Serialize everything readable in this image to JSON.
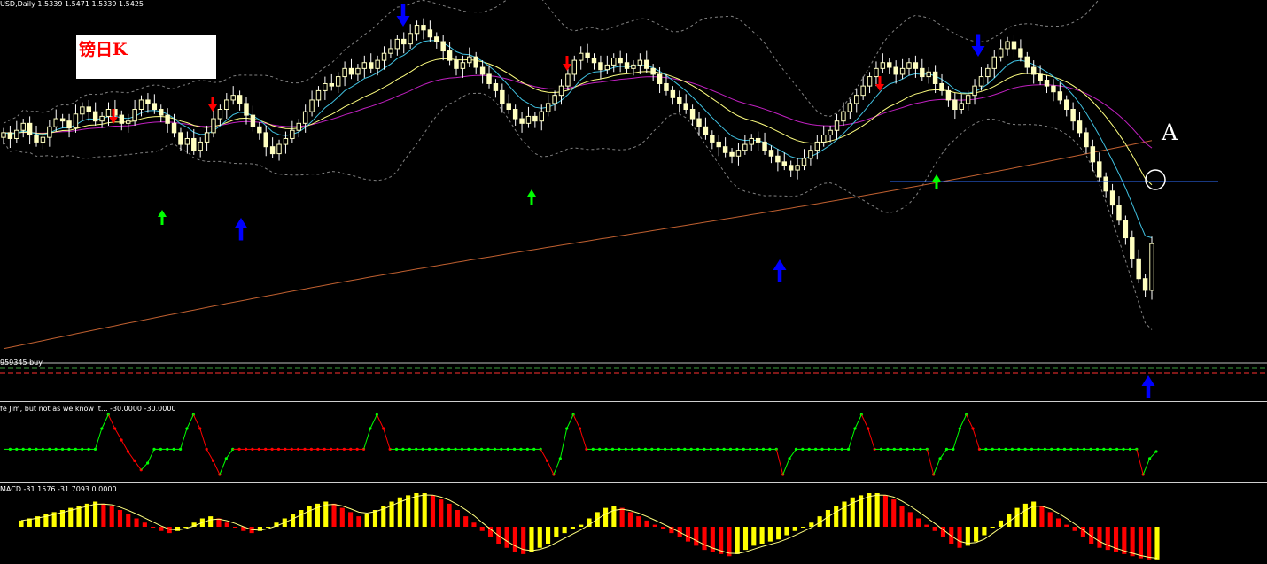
{
  "header": {
    "symbol_info": "USD,Daily  1.5339 1.5471 1.5339 1.5425",
    "chart_label": "镑日K",
    "annotation": "A",
    "level_label": "959345 buy",
    "indicator_title": "fe Jim, but not as we know it...  -30.0000 -30.0000",
    "macd_title": "MACD -31.1576 -31.7093 0.0000"
  },
  "colors": {
    "background": "#000000",
    "bull_candle": "#ffffc0",
    "bear_candle": "#ffffc0",
    "ema_fast": "#40c0e0",
    "ema_mid": "#ffff80",
    "ema_slow": "#c020c0",
    "ema_long": "#c06030",
    "bands": "#808080",
    "arrow_up_green": "#00ff00",
    "arrow_down_red": "#ff0000",
    "arrow_big_blue": "#0000ff",
    "macd_pos": "#ffff00",
    "macd_neg": "#ff0000",
    "signal_line": "#ffff80",
    "horizontal_line": "#3070ff"
  },
  "chart_data": [
    {
      "type": "candlestick",
      "title": "",
      "ylim": [
        1.3,
        1.62
      ],
      "closes": [
        1.52,
        1.515,
        1.522,
        1.528,
        1.518,
        1.512,
        1.516,
        1.525,
        1.532,
        1.53,
        1.524,
        1.536,
        1.542,
        1.538,
        1.53,
        1.534,
        1.54,
        1.535,
        1.528,
        1.53,
        1.54,
        1.548,
        1.545,
        1.54,
        1.535,
        1.528,
        1.52,
        1.51,
        1.515,
        1.505,
        1.512,
        1.52,
        1.532,
        1.54,
        1.548,
        1.552,
        1.545,
        1.535,
        1.525,
        1.52,
        1.508,
        1.502,
        1.51,
        1.515,
        1.522,
        1.528,
        1.538,
        1.548,
        1.556,
        1.562,
        1.56,
        1.568,
        1.575,
        1.57,
        1.575,
        1.58,
        1.575,
        1.582,
        1.588,
        1.592,
        1.6,
        1.596,
        1.605,
        1.612,
        1.608,
        1.602,
        1.598,
        1.59,
        1.582,
        1.575,
        1.58,
        1.585,
        1.576,
        1.57,
        1.562,
        1.556,
        1.545,
        1.54,
        1.532,
        1.528,
        1.534,
        1.53,
        1.538,
        1.545,
        1.552,
        1.56,
        1.57,
        1.582,
        1.588,
        1.584,
        1.58,
        1.574,
        1.578,
        1.584,
        1.58,
        1.575,
        1.578,
        1.582,
        1.575,
        1.57,
        1.562,
        1.556,
        1.55,
        1.545,
        1.54,
        1.532,
        1.525,
        1.518,
        1.512,
        1.508,
        1.503,
        1.5,
        1.505,
        1.51,
        1.515,
        1.512,
        1.505,
        1.5,
        1.495,
        1.492,
        1.488,
        1.492,
        1.498,
        1.505,
        1.512,
        1.518,
        1.522,
        1.53,
        1.538,
        1.545,
        1.552,
        1.56,
        1.568,
        1.575,
        1.58,
        1.576,
        1.57,
        1.575,
        1.58,
        1.575,
        1.568,
        1.572,
        1.562,
        1.556,
        1.548,
        1.54,
        1.545,
        1.552,
        1.56,
        1.568,
        1.575,
        1.585,
        1.592,
        1.598,
        1.592,
        1.585,
        1.576,
        1.57,
        1.565,
        1.56,
        1.555,
        1.548,
        1.54,
        1.53,
        1.52,
        1.508,
        1.495,
        1.482,
        1.47,
        1.458,
        1.445,
        1.43,
        1.412,
        1.395,
        1.385,
        1.425
      ]
    },
    {
      "type": "line",
      "title": "",
      "ylim": [
        -30,
        30
      ],
      "series": [
        {
          "values": [
            -8,
            -8,
            -8,
            -8,
            -8,
            -8,
            -8,
            -8,
            -8,
            -8,
            -8,
            -8,
            -8,
            -8,
            -8,
            10,
            22,
            10,
            0,
            -10,
            -18,
            -26,
            -20,
            -8,
            -8,
            -8,
            -8,
            -8,
            10,
            22,
            10,
            -8,
            -18,
            -30,
            -16,
            -8,
            -8,
            -8,
            -8,
            -8,
            -8,
            -8,
            -8,
            -8,
            -8,
            -8,
            -8,
            -8,
            -8,
            -8,
            -8,
            -8,
            -8,
            -8,
            -8,
            -8,
            10,
            22,
            10,
            -8,
            -8,
            -8,
            -8,
            -8,
            -8,
            -8,
            -8,
            -8,
            -8,
            -8,
            -8,
            -8,
            -8,
            -8,
            -8,
            -8,
            -8,
            -8,
            -8,
            -8,
            -8,
            -8,
            -8,
            -18,
            -30,
            -16,
            10,
            22,
            10,
            -8,
            -8,
            -8,
            -8,
            -8,
            -8,
            -8,
            -8,
            -8,
            -8,
            -8,
            -8,
            -8,
            -8,
            -8,
            -8,
            -8,
            -8,
            -8,
            -8,
            -8,
            -8,
            -8,
            -8,
            -8,
            -8,
            -8,
            -8,
            -8,
            -8,
            -30,
            -16,
            -8,
            -8,
            -8,
            -8,
            -8,
            -8,
            -8,
            -8,
            -8,
            10,
            22,
            10,
            -8,
            -8,
            -8,
            -8,
            -8,
            -8,
            -8,
            -8,
            -8,
            -30,
            -16,
            -8,
            -8,
            10,
            22,
            10,
            -8,
            -8,
            -8,
            -8,
            -8,
            -8,
            -8,
            -8,
            -8,
            -8,
            -8,
            -8,
            -8,
            -8,
            -8,
            -8,
            -8,
            -8,
            -8,
            -8,
            -8,
            -8,
            -8,
            -8,
            -8,
            -30,
            -16,
            -10
          ]
        }
      ]
    },
    {
      "type": "bar",
      "title": "MACD",
      "ylim": [
        -32,
        32
      ],
      "values": [
        6,
        8,
        10,
        12,
        14,
        16,
        18,
        20,
        22,
        24,
        22,
        20,
        16,
        12,
        8,
        4,
        0,
        -4,
        -6,
        -4,
        0,
        4,
        8,
        10,
        8,
        4,
        0,
        -4,
        -6,
        -4,
        0,
        4,
        8,
        12,
        16,
        20,
        22,
        24,
        22,
        18,
        14,
        10,
        12,
        16,
        20,
        24,
        28,
        30,
        32,
        32,
        30,
        26,
        22,
        16,
        10,
        4,
        -4,
        -10,
        -16,
        -20,
        -24,
        -26,
        -24,
        -20,
        -16,
        -10,
        -6,
        -2,
        2,
        8,
        14,
        18,
        20,
        18,
        14,
        10,
        6,
        2,
        -2,
        -6,
        -10,
        -14,
        -18,
        -22,
        -24,
        -26,
        -28,
        -26,
        -22,
        -18,
        -16,
        -14,
        -12,
        -8,
        -4,
        0,
        4,
        10,
        16,
        20,
        24,
        28,
        30,
        32,
        32,
        30,
        26,
        20,
        14,
        8,
        2,
        -4,
        -10,
        -16,
        -20,
        -18,
        -14,
        -8,
        0,
        6,
        12,
        18,
        22,
        24,
        20,
        14,
        8,
        2,
        -4,
        -10,
        -16,
        -20,
        -22,
        -24,
        -26,
        -28,
        -30,
        -31,
        -31
      ]
    }
  ]
}
